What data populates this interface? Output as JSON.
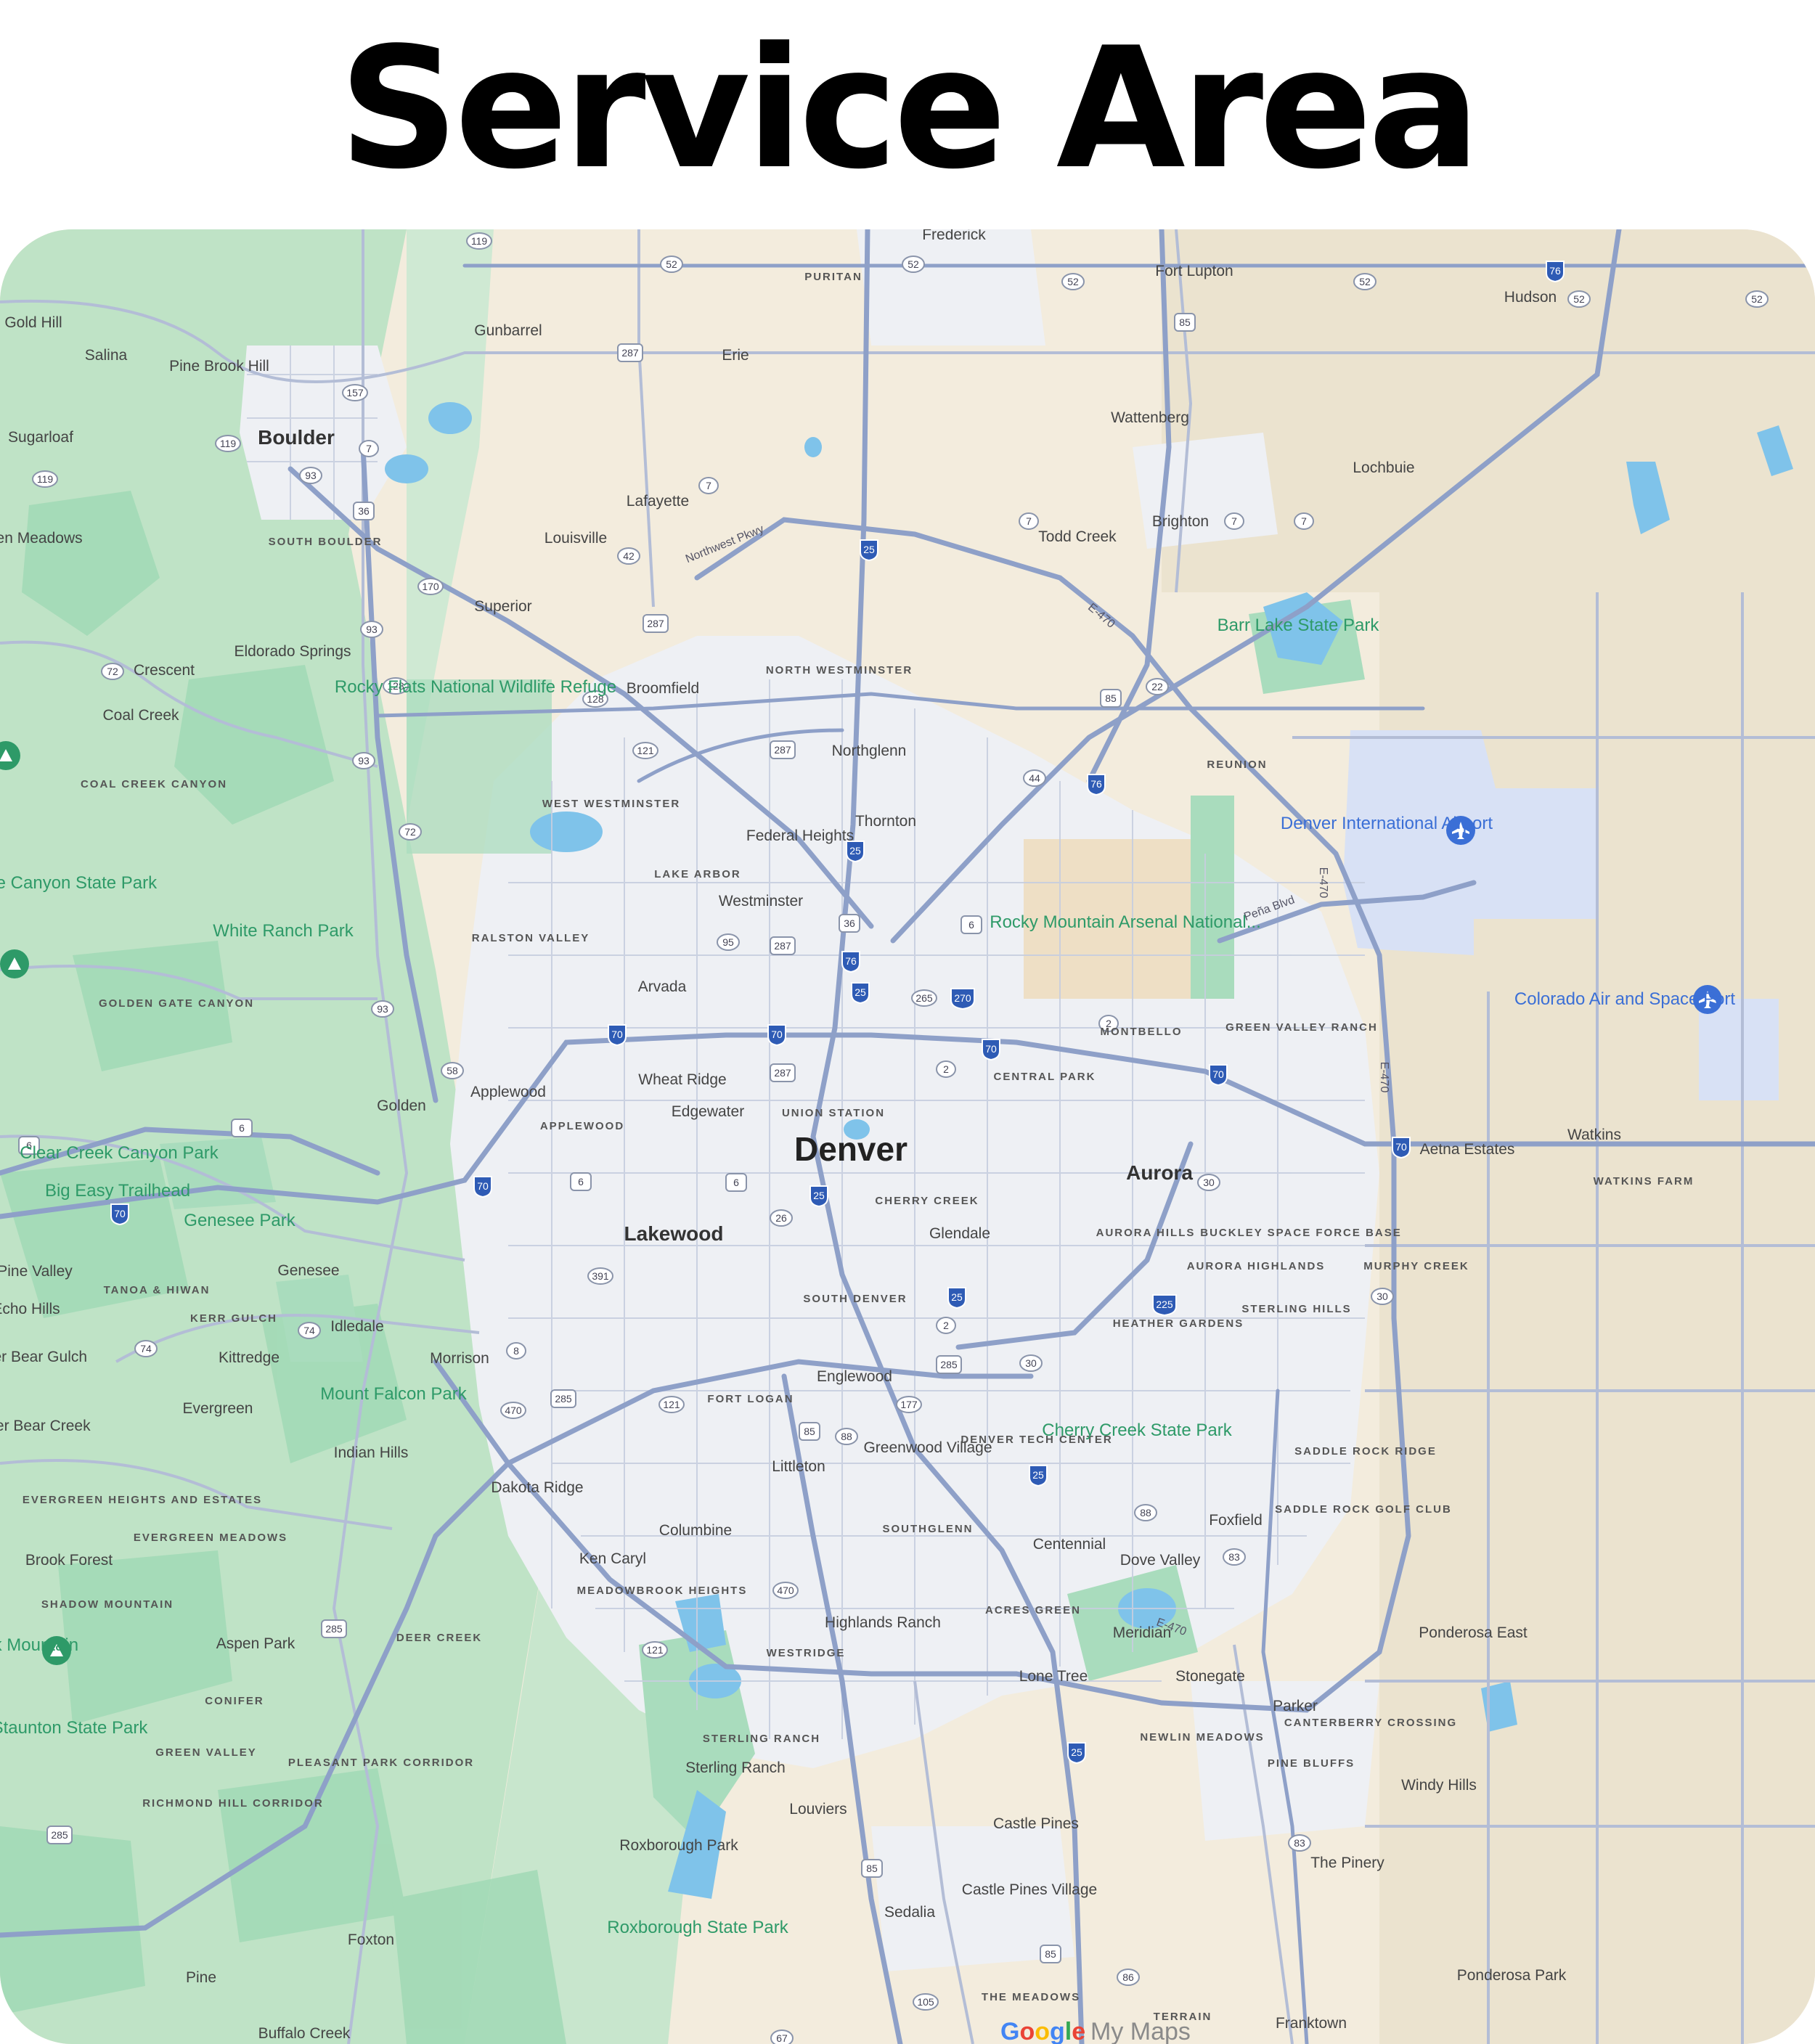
{
  "page": {
    "title": "Service Area"
  },
  "map": {
    "attribution": {
      "brand": "Google",
      "product": "My Maps"
    },
    "colors": {
      "land": "#f3ecdd",
      "forest": "#bfe3c6",
      "park": "#a9dcbd",
      "urban": "#eef0f4",
      "water": "#7fc3ea",
      "highway": "#8ea0c8",
      "road": "#b3bdd6",
      "airport": "#d8e1f5"
    },
    "icons": [
      "airport-icon",
      "campground-icon",
      "interstate-shield-icon",
      "us-route-shield-icon",
      "state-route-shield-icon"
    ],
    "places": {
      "major": [
        "Denver",
        "Aurora",
        "Lakewood",
        "Boulder"
      ],
      "towns": [
        "Frederick",
        "Fort Lupton",
        "Hudson",
        "Gunbarrel",
        "Erie",
        "Gold Hill",
        "Salina",
        "Pine Brook Hill",
        "Sugarloaf",
        "Wattenberg",
        "Lochbuie",
        "Lafayette",
        "Todd Creek",
        "Brighton",
        "Aspen Meadows",
        "Louisville",
        "Superior",
        "Broomfield",
        "Eldorado Springs",
        "Crescent",
        "Coal Creek",
        "Northglenn",
        "Thornton",
        "Federal Heights",
        "Westminster",
        "Arvada",
        "Wheat Ridge",
        "Edgewater",
        "Applewood",
        "Golden",
        "Glendale",
        "Genesee",
        "Idledale",
        "Kittredge",
        "Morrison",
        "Evergreen",
        "Indian Hills",
        "Englewood",
        "Littleton",
        "Greenwood Village",
        "Dakota Ridge",
        "Columbine",
        "Ken Caryl",
        "Brook Forest",
        "Aspen Park",
        "Centennial",
        "Dove Valley",
        "Foxfield",
        "Meridian",
        "Highlands Ranch",
        "Lone Tree",
        "Stonegate",
        "Parker",
        "Ponderosa East",
        "Sterling Ranch",
        "Louviers",
        "Castle Pines",
        "Windy Hills",
        "The Pinery",
        "Roxborough Park",
        "Sedalia",
        "Castle Pines Village",
        "Foxton",
        "Pine",
        "Buffalo Creek",
        "Ponderosa Park",
        "Franktown",
        "Watkins",
        "Aetna Estates",
        "Pine Valley",
        "Echo Hills",
        "Upper Bear Creek",
        "Upper Bear Gulch"
      ],
      "neighborhoods": [
        "PURITAN",
        "SOUTH BOULDER",
        "NORTH WESTMINSTER",
        "WEST WESTMINSTER",
        "LAKE ARBOR",
        "RALSTON VALLEY",
        "COAL CREEK CANYON",
        "GOLDEN GATE CANYON",
        "REUNION",
        "MONTBELLO",
        "GREEN VALLEY RANCH",
        "CENTRAL PARK",
        "UNION STATION",
        "APPLEWOOD",
        "CHERRY CREEK",
        "AURORA HILLS",
        "BUCKLEY SPACE FORCE BASE",
        "AURORA HIGHLANDS",
        "MURPHY CREEK",
        "STERLING HILLS",
        "HEATHER GARDENS",
        "SOUTH DENVER",
        "FORT LOGAN",
        "DENVER TECH CENTER",
        "SADDLE ROCK RIDGE",
        "SADDLE ROCK GOLF CLUB",
        "SOUTHGLENN",
        "MEADOWBROOK HEIGHTS",
        "ACRES GREEN",
        "WESTRIDGE",
        "NEWLIN MEADOWS",
        "CANTERBERRY CROSSING",
        "PINE BLUFFS",
        "STERLING RANCH",
        "THE MEADOWS",
        "TERRAIN",
        "WATKINS FARM",
        "TANOA & HIWAN",
        "KERR GULCH",
        "EVERGREEN HEIGHTS AND ESTATES",
        "EVERGREEN MEADOWS",
        "SHADOW MOUNTAIN",
        "DEER CREEK",
        "CONIFER",
        "GREEN VALLEY",
        "PLEASANT PARK CORRIDOR",
        "RICHMOND HILL CORRIDOR"
      ],
      "parks": [
        "Barr Lake State Park",
        "Rocky Flats National Wildlife Refuge",
        "Rocky Mountain Arsenal National...",
        "White Ranch Park",
        "Clear Creek Canyon Park",
        "Big Easy Trailhead",
        "Genesee Park",
        "Mount Falcon Park",
        "Cherry Creek State Park",
        "Staunton State Park",
        "Roxborough State Park",
        "Golden Gate Canyon State Park",
        "Black Mountain"
      ],
      "airports": [
        "Denver International Airport",
        "Colorado Air and Space Port"
      ],
      "roads": [
        "Northwest Pkwy",
        "E-470",
        "Peña Blvd"
      ]
    },
    "shields": {
      "interstates": [
        "25",
        "76",
        "70",
        "225",
        "270"
      ],
      "us_routes": [
        "287",
        "36",
        "85",
        "6",
        "285"
      ],
      "state_routes": [
        "119",
        "52",
        "157",
        "7",
        "93",
        "170",
        "128",
        "121",
        "72",
        "95",
        "58",
        "2",
        "44",
        "22",
        "265",
        "391",
        "26",
        "74",
        "8",
        "470",
        "177",
        "88",
        "30",
        "83",
        "86",
        "105",
        "67",
        "42"
      ]
    }
  }
}
